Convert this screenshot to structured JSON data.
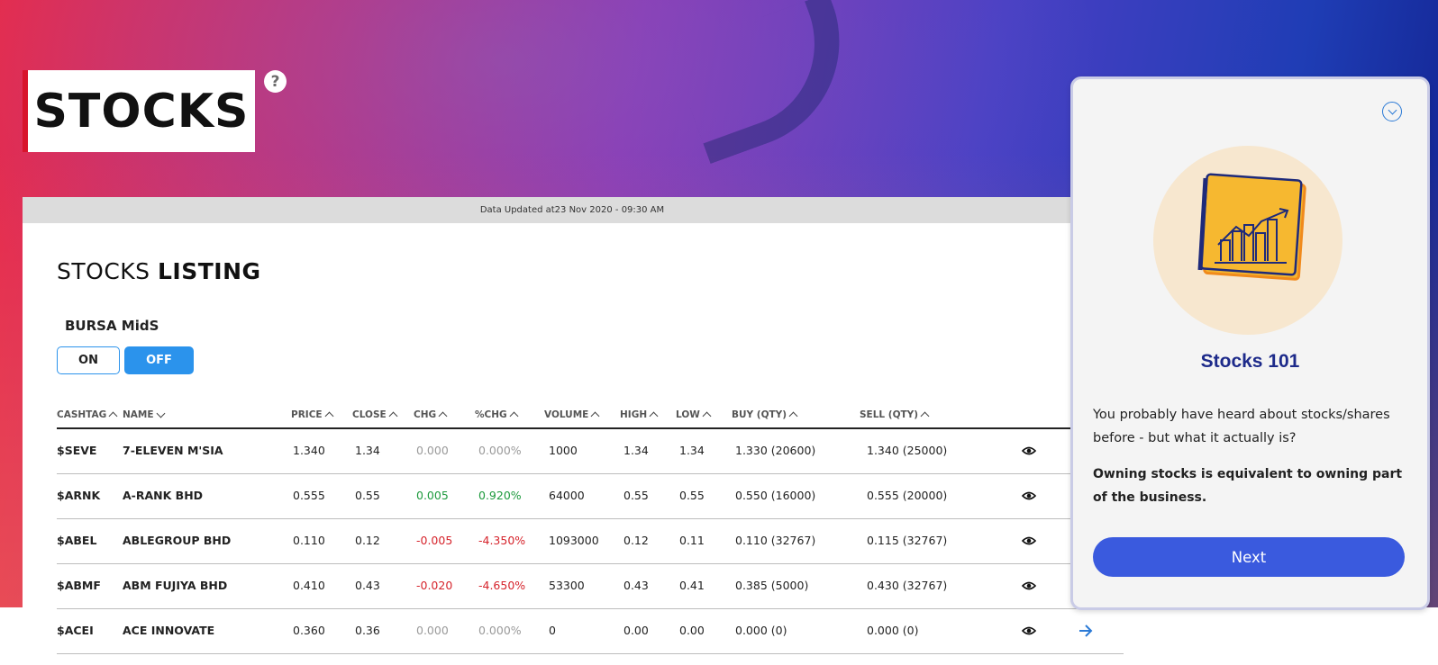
{
  "page": {
    "title": "STOCKS",
    "help_label": "?"
  },
  "card": {
    "updated_text": "Data Updated at23 Nov 2020 - 09:30 AM",
    "listing_title_prefix": "STOCKS ",
    "listing_title_bold": "LISTING",
    "midS_label": "BURSA MidS",
    "toggle_on": "ON",
    "toggle_off": "OFF",
    "toggle_selected": "OFF"
  },
  "table": {
    "headers": {
      "cashtag": "CASHTAG",
      "name": "NAME",
      "price": "PRICE",
      "close": "CLOSE",
      "chg": "CHG",
      "pct_chg": "%CHG",
      "volume": "VOLUME",
      "high": "HIGH",
      "low": "LOW",
      "buy": "BUY (QTY)",
      "sell": "SELL (QTY)"
    },
    "rows": [
      {
        "cashtag": "$SEVE",
        "name": "7-ELEVEN M'SIA",
        "price": "1.340",
        "close": "1.34",
        "chg": "0.000",
        "pct_chg": "0.000%",
        "volume": "1000",
        "high": "1.34",
        "low": "1.34",
        "buy": "1.330 (20600)",
        "sell": "1.340 (25000)",
        "trend": "neutral"
      },
      {
        "cashtag": "$ARNK",
        "name": "A-RANK BHD",
        "price": "0.555",
        "close": "0.55",
        "chg": "0.005",
        "pct_chg": "0.920%",
        "volume": "64000",
        "high": "0.55",
        "low": "0.55",
        "buy": "0.550 (16000)",
        "sell": "0.555 (20000)",
        "trend": "pos"
      },
      {
        "cashtag": "$ABEL",
        "name": "ABLEGROUP BHD",
        "price": "0.110",
        "close": "0.12",
        "chg": "-0.005",
        "pct_chg": "-4.350%",
        "volume": "1093000",
        "high": "0.12",
        "low": "0.11",
        "buy": "0.110 (32767)",
        "sell": "0.115 (32767)",
        "trend": "neg"
      },
      {
        "cashtag": "$ABMF",
        "name": "ABM FUJIYA BHD",
        "price": "0.410",
        "close": "0.43",
        "chg": "-0.020",
        "pct_chg": "-4.650%",
        "volume": "53300",
        "high": "0.43",
        "low": "0.41",
        "buy": "0.385 (5000)",
        "sell": "0.430 (32767)",
        "trend": "neg"
      },
      {
        "cashtag": "$ACEI",
        "name": "ACE INNOVATE",
        "price": "0.360",
        "close": "0.36",
        "chg": "0.000",
        "pct_chg": "0.000%",
        "volume": "0",
        "high": "0.00",
        "low": "0.00",
        "buy": "0.000 (0)",
        "sell": "0.000 (0)",
        "trend": "neutral"
      }
    ]
  },
  "panel": {
    "title": "Stocks 101",
    "text": "You probably have heard about stocks/shares before - but what it actually is?",
    "bold_text": "Owning stocks is equivalent to owning part of the business.",
    "next_label": "Next",
    "illustration_icon": "chart-notebook-icon"
  },
  "colors": {
    "accent_blue": "#2b93ec",
    "next_button": "#3a5ade",
    "positive": "#1d9a3d",
    "negative": "#d6242c",
    "panel_title": "#1d2a8a"
  }
}
